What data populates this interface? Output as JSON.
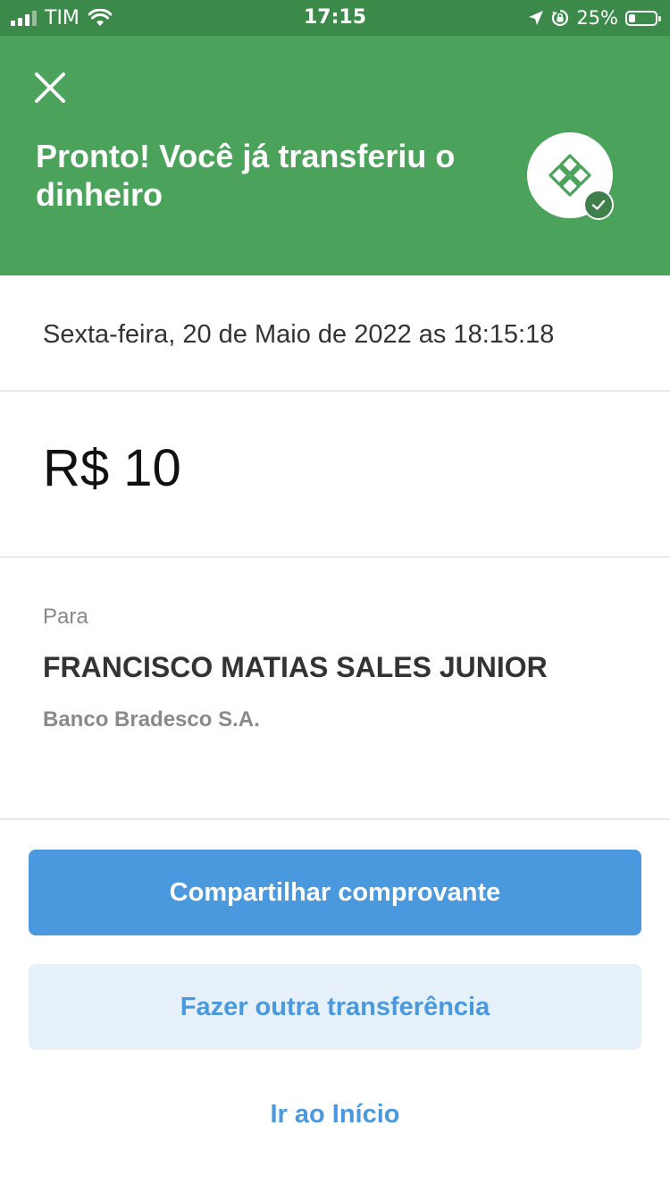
{
  "status_bar": {
    "carrier": "TIM",
    "time": "17:15",
    "battery_percent_label": "25%",
    "battery_level": 0.25
  },
  "header": {
    "title": "Pronto! Você já transferiu o dinheiro",
    "close_icon": "close-icon",
    "logo_icon": "pix-logo-icon",
    "badge_icon": "check-icon"
  },
  "transfer": {
    "date": "Sexta-feira, 20 de Maio de 2022 as 18:15:18",
    "amount": "R$ 10",
    "to_label": "Para",
    "recipient": "FRANCISCO MATIAS SALES JUNIOR",
    "bank": "Banco Bradesco S.A."
  },
  "actions": {
    "share_label": "Compartilhar comprovante",
    "another_label": "Fazer outra transferência",
    "home_label": "Ir ao Início"
  },
  "colors": {
    "status_bar": "#3c8a49",
    "header": "#4ba35b",
    "primary": "#4a98de",
    "secondary_bg": "#e5f0f8"
  }
}
